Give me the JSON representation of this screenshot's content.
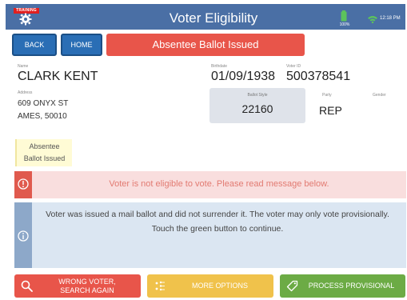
{
  "header": {
    "training_tag": "TRAINING",
    "title": "Voter Eligibility",
    "battery_level": "100%",
    "time": "12:18 PM",
    "icons": [
      "gear-icon",
      "battery-icon",
      "wifi-icon"
    ]
  },
  "nav": {
    "back_label": "BACK",
    "home_label": "HOME",
    "status_label": "Absentee Ballot Issued"
  },
  "voter": {
    "name_label": "Name",
    "name": "CLARK KENT",
    "address_label": "Address",
    "address_line1": "609 ONYX ST",
    "address_line2": "AMES, 50010",
    "birthdate_label": "Birthdate",
    "birthdate": "01/09/1938",
    "voter_id_label": "Voter ID",
    "voter_id": "500378541",
    "ballot_style_label": "Ballot Style",
    "ballot_style": "22160",
    "party_label": "Party",
    "party": "REP",
    "gender_label": "Gender",
    "gender": ""
  },
  "badge": {
    "line1": "Absentee",
    "line2": "Ballot Issued"
  },
  "alerts": {
    "warning": "Voter is not eligible to vote.  Please read message below.",
    "info": "Voter was issued a mail ballot and did not surrender it. The voter may only vote provisionally. Touch the green button to continue."
  },
  "actions": {
    "wrong_voter_line1": "WRONG VOTER,",
    "wrong_voter_line2": "SEARCH AGAIN",
    "more_options": "MORE OPTIONS",
    "process_provisional": "PROCESS PROVISIONAL"
  },
  "colors": {
    "header": "#4a6fa5",
    "primary": "#2a6eb5",
    "danger": "#e8554a",
    "warning": "#f0c24b",
    "success": "#6cab45"
  }
}
